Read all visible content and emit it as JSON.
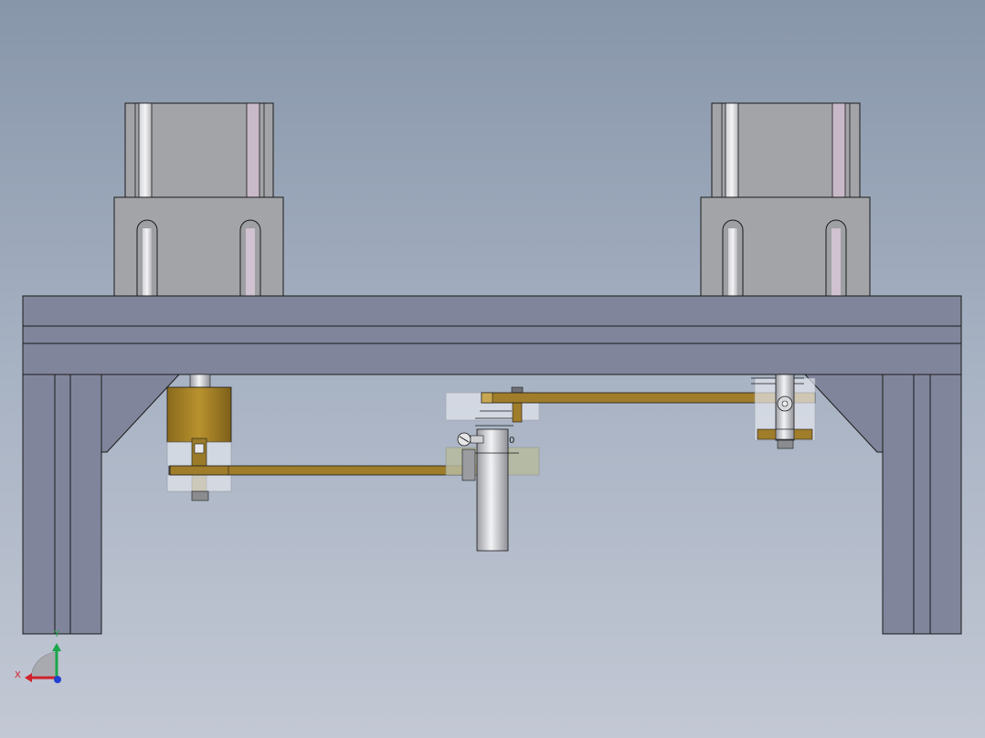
{
  "triad": {
    "x_label": "X",
    "y_label": "Y",
    "x_color": "#d0202a",
    "y_color": "#1aa64a",
    "z_color": "#2040d0"
  },
  "part_labels": {
    "center_mark": "0"
  },
  "colors": {
    "frame_fill": "#80859b",
    "frame_stroke": "#1a1a1a",
    "motor_fill": "#a3a4a8",
    "motor_slot": "#e6e6ea",
    "brass": "#a07d2a",
    "brass_light": "#c9a650",
    "transparent_part": "#dfe3ea",
    "shaft": "#d0d2d6"
  }
}
